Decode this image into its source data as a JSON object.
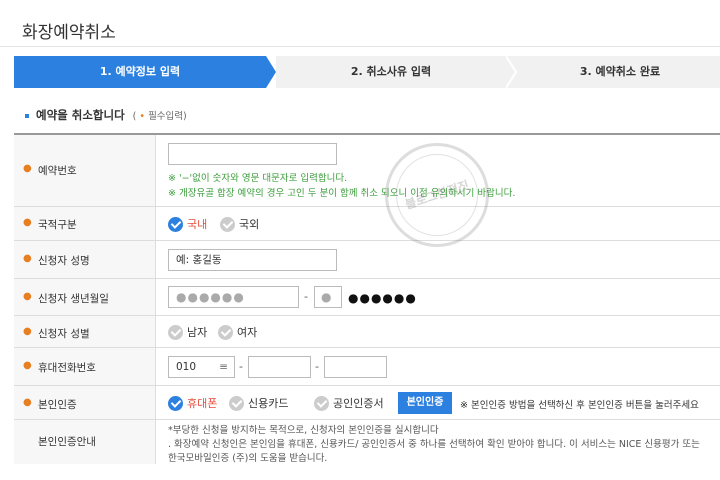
{
  "page": {
    "title": "화장예약취소"
  },
  "steps": [
    {
      "label": "1. 예약정보 입력"
    },
    {
      "label": "2. 취소사유 입력"
    },
    {
      "label": "3. 예약취소 완료"
    }
  ],
  "section": {
    "title": "예약을 취소합니다",
    "required_open": "(",
    "required_dot": "•",
    "required_text": "필수입력)"
  },
  "form": {
    "reservation_number": {
      "label": "예약번호",
      "value": "",
      "note1": "※ '−'없이 숫자와 영문 대문자로 입력합니다.",
      "note2": "※ 개장유골 합장 예약의 경우 고인 두 분이 함께 취소 되오니 이점 유의하시기 바랍니다."
    },
    "nationality": {
      "label": "국적구분",
      "options": [
        "국내",
        "국외"
      ],
      "selected": "국내"
    },
    "applicant_name": {
      "label": "신청자 성명",
      "placeholder": "예: 홍길동"
    },
    "birthdate": {
      "label": "신청자 생년월일",
      "front_masked": "●●●●●●",
      "back_first_masked": "●",
      "back_rest_masked": "●●●●●●",
      "separator": "-"
    },
    "gender": {
      "label": "신청자 성별",
      "options": [
        "남자",
        "여자"
      ],
      "selected": ""
    },
    "mobile": {
      "label": "휴대전화번호",
      "prefix": "010",
      "select_icon": "≡",
      "separator": "-",
      "middle": "",
      "last": ""
    },
    "verification": {
      "label": "본인인증",
      "options": [
        "휴대폰",
        "신용카드",
        "공인인증서"
      ],
      "selected": "휴대폰",
      "button_label": "본인인증",
      "note": "※ 본인인증 방법을 선택하신 후 본인인증 버튼을 눌러주세요"
    },
    "verification_guide": {
      "label": "본인인증안내",
      "line1": "*부당한 신청을 방지하는 목적으로, 신청자의 본인인증을 실시합니다",
      "line2": ". 화장예약 신청인은 본인임을 휴대폰, 신용카드/ 공인인증서 중 하나를 선택하여 확인 받아야 합니다. 이 서비스는 NICE 신용평가 또는",
      "line3": "한국모바일인증 (주)의 도움을 받습니다."
    }
  },
  "watermark": {
    "text": "블로그한정짓"
  },
  "colors": {
    "accent": "#2c80df",
    "bullet": "#e67e22",
    "note_green": "#3c9e3c",
    "selected_red": "#e74c3c"
  }
}
